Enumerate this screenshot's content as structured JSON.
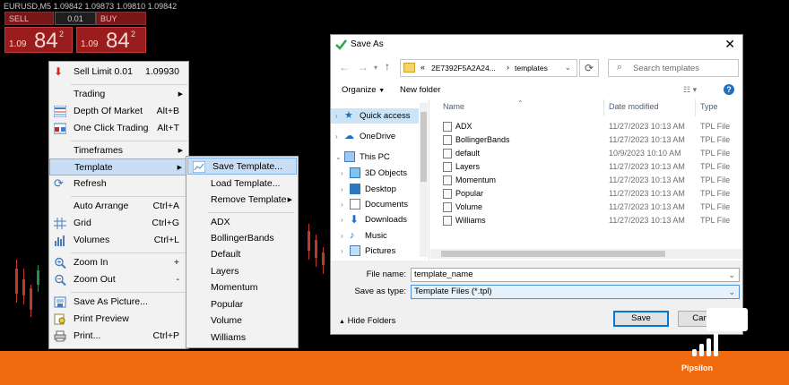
{
  "chart": {
    "symbol": "EURUSD,M5  1.09842 1.09873 1.09810 1.09842",
    "sell_label": "SELL",
    "buy_label": "BUY",
    "lot": "0.01",
    "sell_small": "1.09",
    "sell_big": "84",
    "sell_sup": "2",
    "buy_small": "1.09",
    "buy_big": "84",
    "buy_sup": "2"
  },
  "context_menu": {
    "sell_limit": {
      "label": "Sell Limit 0.01",
      "value": "1.09930"
    },
    "trading": "Trading",
    "depth": {
      "label": "Depth Of Market",
      "key": "Alt+B"
    },
    "one_click": {
      "label": "One Click Trading",
      "key": "Alt+T"
    },
    "timeframes": "Timeframes",
    "template": "Template",
    "refresh": "Refresh",
    "auto_arrange": {
      "label": "Auto Arrange",
      "key": "Ctrl+A"
    },
    "grid": {
      "label": "Grid",
      "key": "Ctrl+G"
    },
    "volumes": {
      "label": "Volumes",
      "key": "Ctrl+L"
    },
    "zoom_in": {
      "label": "Zoom In",
      "key": "+"
    },
    "zoom_out": {
      "label": "Zoom Out",
      "key": "-"
    },
    "save_picture": "Save As Picture...",
    "print_preview": "Print Preview",
    "print": {
      "label": "Print...",
      "key": "Ctrl+P"
    }
  },
  "template_menu": {
    "save": "Save Template...",
    "load": "Load Template...",
    "remove": "Remove Template",
    "items": [
      "ADX",
      "BollingerBands",
      "Default",
      "Layers",
      "Momentum",
      "Popular",
      "Volume",
      "Williams"
    ]
  },
  "dialog": {
    "title": "Save As",
    "close": "✕",
    "address": {
      "prefix": "«",
      "folder": "2E7392F5A2A24...",
      "sep": "›",
      "current": "templates"
    },
    "search_placeholder": "Search templates",
    "organize": "Organize",
    "new_folder": "New folder",
    "nav": [
      "Quick access",
      "OneDrive",
      "This PC",
      "3D Objects",
      "Desktop",
      "Documents",
      "Downloads",
      "Music",
      "Pictures"
    ],
    "columns": {
      "name": "Name",
      "date": "Date modified",
      "type": "Type"
    },
    "files": [
      {
        "name": "ADX",
        "date": "11/27/2023 10:13 AM",
        "type": "TPL File"
      },
      {
        "name": "BollingerBands",
        "date": "11/27/2023 10:13 AM",
        "type": "TPL File"
      },
      {
        "name": "default",
        "date": "10/9/2023 10:10 AM",
        "type": "TPL File"
      },
      {
        "name": "Layers",
        "date": "11/27/2023 10:13 AM",
        "type": "TPL File"
      },
      {
        "name": "Momentum",
        "date": "11/27/2023 10:13 AM",
        "type": "TPL File"
      },
      {
        "name": "Popular",
        "date": "11/27/2023 10:13 AM",
        "type": "TPL File"
      },
      {
        "name": "Volume",
        "date": "11/27/2023 10:13 AM",
        "type": "TPL File"
      },
      {
        "name": "Williams",
        "date": "11/27/2023 10:13 AM",
        "type": "TPL File"
      }
    ],
    "file_name_label": "File name:",
    "file_name_value": "template_name",
    "save_type_label": "Save as type:",
    "save_type_value": "Template Files (*.tpl)",
    "hide_folders": "Hide Folders",
    "save_button": "Save",
    "cancel_button": "Cancel"
  },
  "footer": {
    "brand": "Pipsilon"
  },
  "colors": {
    "footer": "#f06a0f",
    "menu_highlight": "#c9def5",
    "sell_panel": "#9a1c1c"
  }
}
